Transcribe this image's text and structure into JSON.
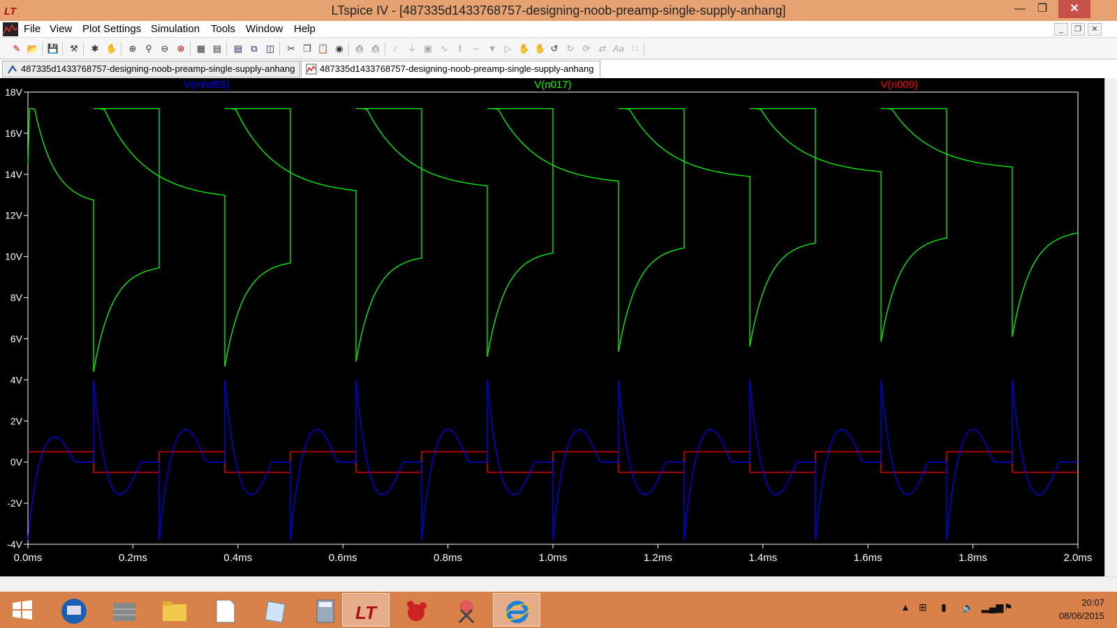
{
  "window": {
    "title": "LTspice IV - [487335d1433768757-designing-noob-preamp-single-supply-anhang]",
    "minimize_glyph": "—",
    "restore_glyph": "❐",
    "close_glyph": "✕"
  },
  "menu": [
    {
      "label": "File"
    },
    {
      "label": "View"
    },
    {
      "label": "Plot Settings"
    },
    {
      "label": "Simulation"
    },
    {
      "label": "Tools"
    },
    {
      "label": "Window"
    },
    {
      "label": "Help"
    }
  ],
  "mdi_buttons": {
    "minimize": "_",
    "restore": "❐",
    "close": "✕"
  },
  "toolbar_icons": [
    "new-schematic-icon",
    "open-icon",
    "save-icon",
    "control-panel-icon",
    "run-icon",
    "pan-hand-icon",
    "zoom-in-icon",
    "zoom-area-icon",
    "zoom-out-icon",
    "zoom-fit-icon",
    "autorange-icon",
    "marching-waveforms-icon",
    "tile-horizontal-icon",
    "cascade-icon",
    "tile-vertical-icon",
    "cut-icon",
    "copy-icon",
    "paste-icon",
    "find-icon",
    "print-preview-icon",
    "print-icon",
    "wire-icon",
    "ground-icon",
    "label-net-icon",
    "resistor-icon",
    "capacitor-icon",
    "inductor-icon",
    "diode-icon",
    "component-icon",
    "move-icon",
    "drag-icon",
    "undo-icon",
    "redo-icon",
    "rotate-icon",
    "mirror-icon",
    "text-icon",
    "spice-directive-icon"
  ],
  "tabs": [
    {
      "label": "487335d1433768757-designing-noob-preamp-single-supply-anhang",
      "icon": "schematic-icon",
      "active": false
    },
    {
      "label": "487335d1433768757-designing-noob-preamp-single-supply-anhang",
      "icon": "waveform-icon",
      "active": true
    }
  ],
  "chart_data": {
    "type": "line",
    "background": "#000000",
    "xlabel": "",
    "ylabel": "",
    "xlim": [
      0.0,
      2.0
    ],
    "ylim": [
      -4,
      18
    ],
    "x_ticks": [
      "0.0ms",
      "0.2ms",
      "0.4ms",
      "0.6ms",
      "0.8ms",
      "1.0ms",
      "1.2ms",
      "1.4ms",
      "1.6ms",
      "1.8ms",
      "2.0ms"
    ],
    "x_tick_values": [
      0.0,
      0.2,
      0.4,
      0.6,
      0.8,
      1.0,
      1.2,
      1.4,
      1.6,
      1.8,
      2.0
    ],
    "y_ticks": [
      "18V",
      "16V",
      "14V",
      "12V",
      "10V",
      "8V",
      "6V",
      "4V",
      "2V",
      "0V",
      "-2V",
      "-4V"
    ],
    "y_tick_values": [
      18,
      16,
      14,
      12,
      10,
      8,
      6,
      4,
      2,
      0,
      -2,
      -4
    ],
    "period_ms": 0.25,
    "series": [
      {
        "name": "V(mhd55)",
        "color": "#0000ff",
        "shape": "differentiated-square",
        "peak_after_rising_edge": 4.0,
        "trough_after_falling_edge": -3.8,
        "positive_hump": 1.8,
        "negative_hump": -1.8
      },
      {
        "name": "V(n017)",
        "color": "#00ff00",
        "shape": "rc-clipped-square",
        "high_peak": 17.2,
        "high_end_first": 12.5,
        "high_end_last": 14.2,
        "low_trough_first": 4.4,
        "low_trough_last": 6.1,
        "low_end_first": 9.6,
        "low_end_last": 11.3
      },
      {
        "name": "V(n009)",
        "color": "#ff0000",
        "shape": "square",
        "high": 0.5,
        "low": -0.5,
        "first_fall_ms": 0.125
      }
    ]
  },
  "taskbar": {
    "apps": [
      "start-icon",
      "remote-desktop-icon",
      "firewall-icon",
      "file-explorer-icon",
      "notepad-icon",
      "notes-icon",
      "calculator-icon",
      "ltspice-icon",
      "gimp-icon",
      "snipping-tool-icon",
      "internet-explorer-icon"
    ],
    "tray_icons": [
      "show-hidden-icon",
      "windows-icon",
      "battery-icon",
      "volume-icon",
      "network-icon",
      "action-center-icon"
    ],
    "time": "20:07",
    "date": "08/06/2015"
  }
}
